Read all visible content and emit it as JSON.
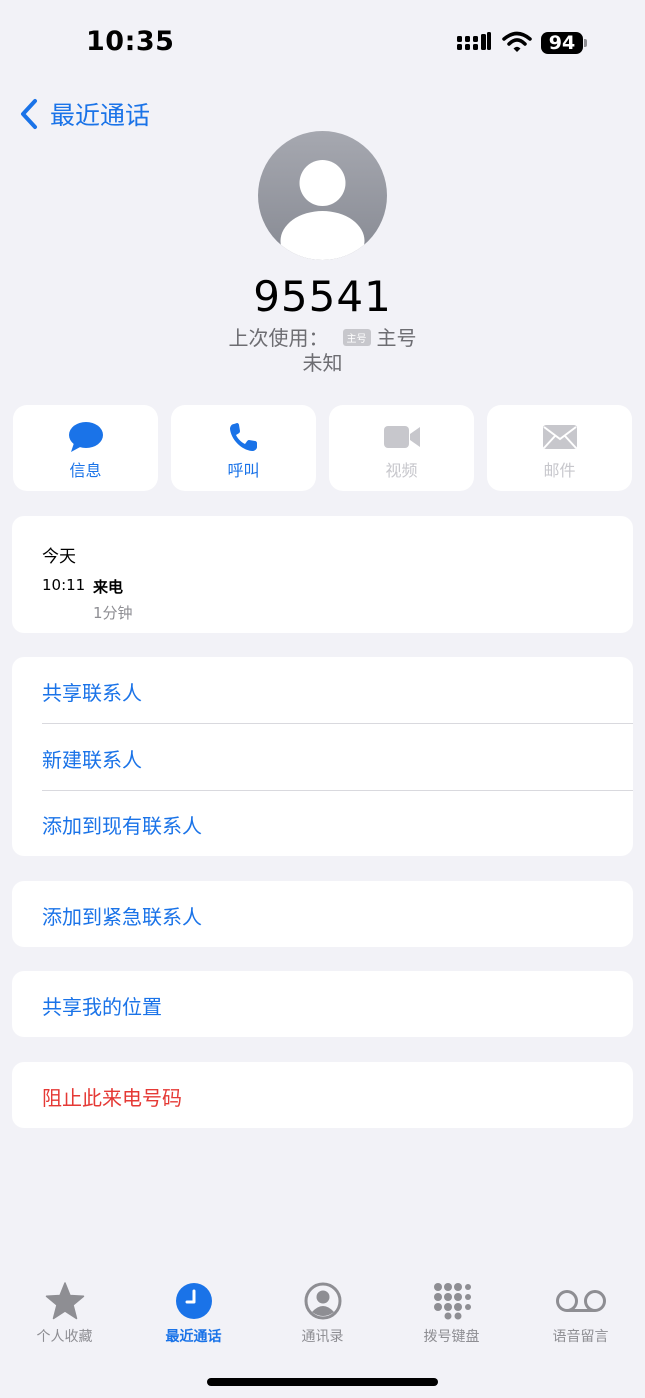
{
  "status_bar": {
    "time": "10:35",
    "battery": "94"
  },
  "nav": {
    "back_label": "最近通话"
  },
  "contact": {
    "number": "95541",
    "last_used_label": "上次使用：",
    "sim_badge": "主号",
    "sim_name": "主号",
    "status": "未知"
  },
  "actions": [
    {
      "label": "信息",
      "icon": "message-icon",
      "enabled": true
    },
    {
      "label": "呼叫",
      "icon": "phone-icon",
      "enabled": true
    },
    {
      "label": "视频",
      "icon": "video-icon",
      "enabled": false
    },
    {
      "label": "邮件",
      "icon": "mail-icon",
      "enabled": false
    }
  ],
  "call_history": {
    "date": "今天",
    "entries": [
      {
        "time": "10:11",
        "type": "来电",
        "duration": "1分钟"
      }
    ]
  },
  "options_group1": [
    {
      "label": "共享联系人"
    },
    {
      "label": "新建联系人"
    },
    {
      "label": "添加到现有联系人"
    }
  ],
  "options": {
    "emergency": "添加到紧急联系人",
    "share_location": "共享我的位置",
    "block": "阻止此来电号码"
  },
  "tab_bar": [
    {
      "label": "个人收藏",
      "icon": "star-icon",
      "selected": false
    },
    {
      "label": "最近通话",
      "icon": "clock-icon",
      "selected": true
    },
    {
      "label": "通讯录",
      "icon": "person-circle-icon",
      "selected": false
    },
    {
      "label": "拨号键盘",
      "icon": "keypad-icon",
      "selected": false
    },
    {
      "label": "语音留言",
      "icon": "voicemail-icon",
      "selected": false
    }
  ],
  "colors": {
    "accent": "#1a73e8",
    "destructive": "#e53935",
    "background": "#f2f2f7",
    "disabled": "#c7c7cc"
  }
}
